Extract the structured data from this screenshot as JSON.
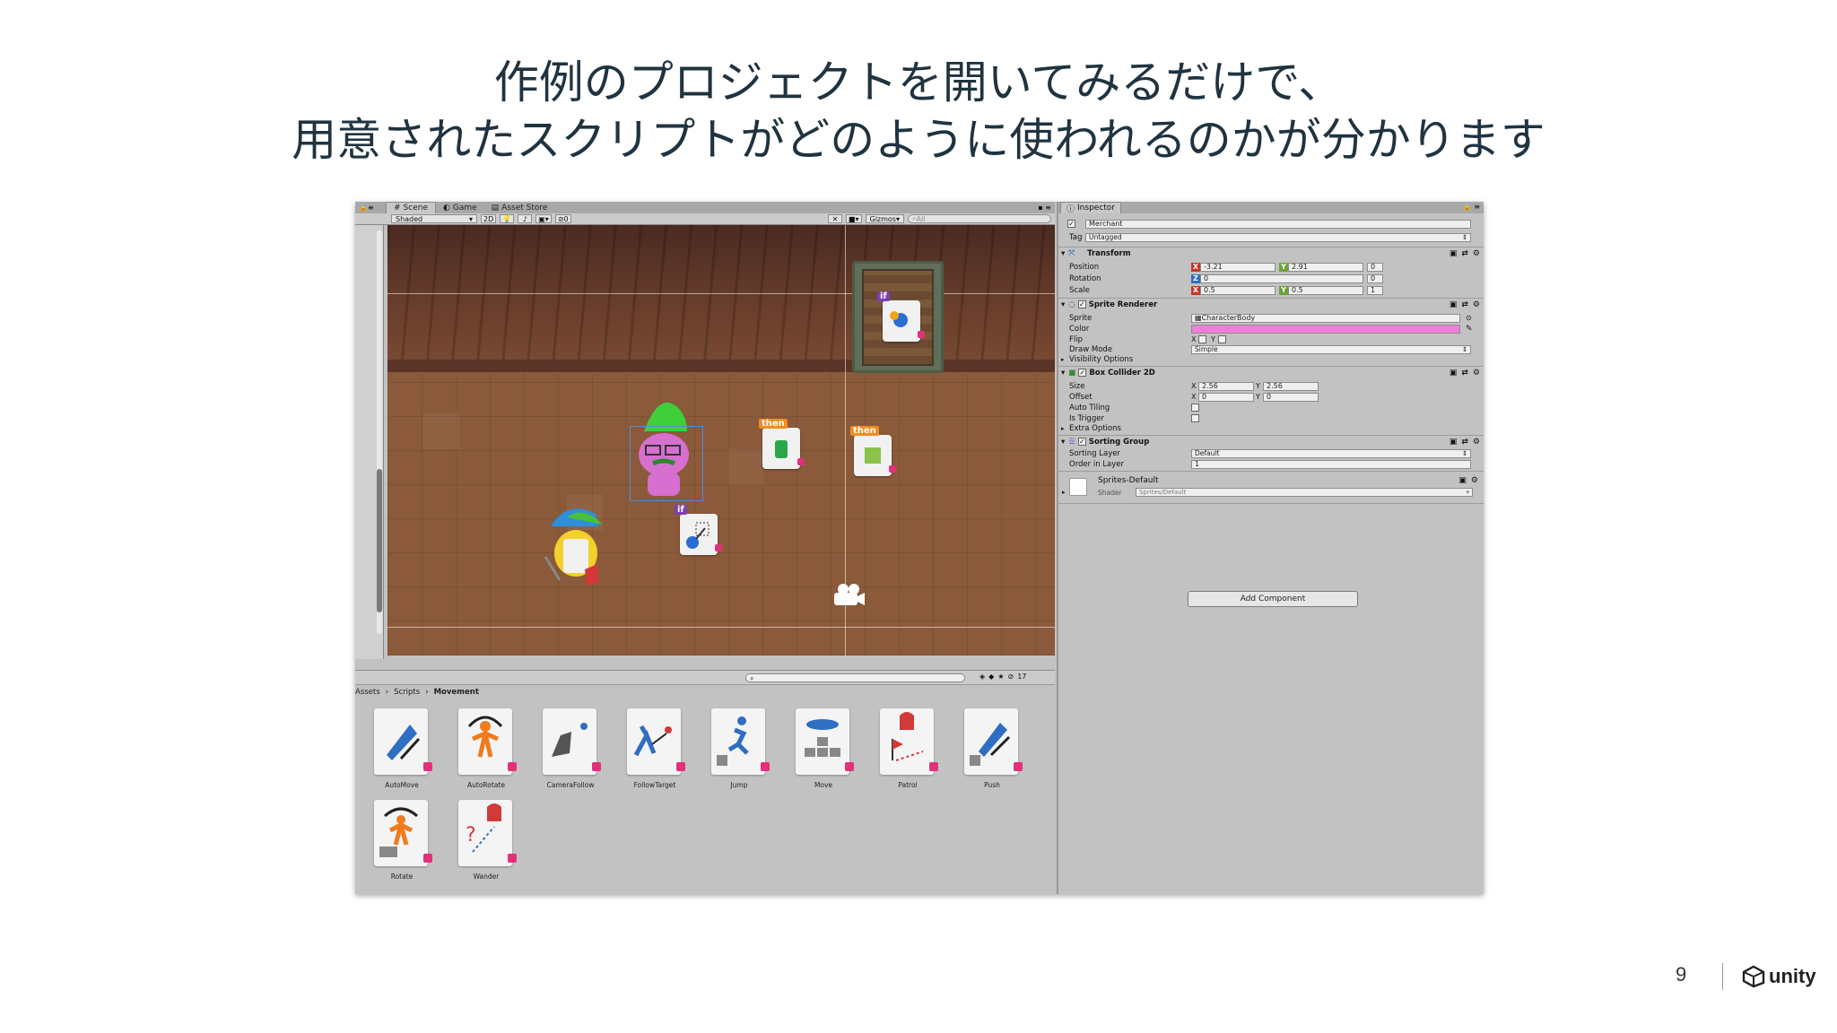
{
  "slide": {
    "title_line1": "作例のプロジェクトを開いてみるだけで、",
    "title_line2": "用意されたスクリプトがどのように使われるのかが分かります",
    "page_number": "9",
    "logo_text": "unity"
  },
  "scene": {
    "tabs": [
      "Scene",
      "Game",
      "Asset Store"
    ],
    "active_tab": "Scene",
    "shading_mode": "Shaded",
    "mode_2d": "2D",
    "count_badge": "0",
    "gizmos_label": "Gizmos",
    "search_placeholder": "All",
    "tag_if": "if",
    "tag_then": "then"
  },
  "project": {
    "breadcrumb": [
      "Assets",
      "Scripts",
      "Movement"
    ],
    "item_count": "17",
    "assets": [
      "AutoMove",
      "AutoRotate",
      "CameraFollow",
      "FollowTarget",
      "Jump",
      "Move",
      "Patrol",
      "Push",
      "Rotate",
      "Wander"
    ]
  },
  "inspector": {
    "tab": "Inspector",
    "object_name": "Merchant",
    "tag_label": "Tag",
    "tag_value": "Untagged",
    "transform": {
      "title": "Transform",
      "position_label": "Position",
      "rotation_label": "Rotation",
      "scale_label": "Scale",
      "pos_x": "-3.21",
      "pos_y": "2.91",
      "pos_z": "0",
      "rot_x": "0",
      "rot_y": "0",
      "scale_x": "0.5",
      "scale_y": "0.5",
      "scale_z": "1"
    },
    "sprite_renderer": {
      "title": "Sprite Renderer",
      "sprite_label": "Sprite",
      "sprite_value": "CharacterBody",
      "color_label": "Color",
      "color_value": "#f07ddc",
      "flip_label": "Flip",
      "flip_x": "X",
      "flip_y": "Y",
      "draw_mode_label": "Draw Mode",
      "draw_mode_value": "Simple",
      "visibility_label": "Visibility Options"
    },
    "box_collider": {
      "title": "Box Collider 2D",
      "size_label": "Size",
      "size_x": "2.56",
      "size_y": "2.56",
      "offset_label": "Offset",
      "offset_x": "0",
      "offset_y": "0",
      "auto_tiling_label": "Auto Tiling",
      "is_trigger_label": "Is Trigger",
      "extra_label": "Extra Options",
      "axis_x": "X",
      "axis_y": "Y"
    },
    "sorting_group": {
      "title": "Sorting Group",
      "layer_label": "Sorting Layer",
      "layer_value": "Default",
      "order_label": "Order in Layer",
      "order_value": "1"
    },
    "material": {
      "name": "Sprites-Default",
      "shader_label": "Shader",
      "shader_value": "Sprites/Default"
    },
    "add_component": "Add Component"
  }
}
